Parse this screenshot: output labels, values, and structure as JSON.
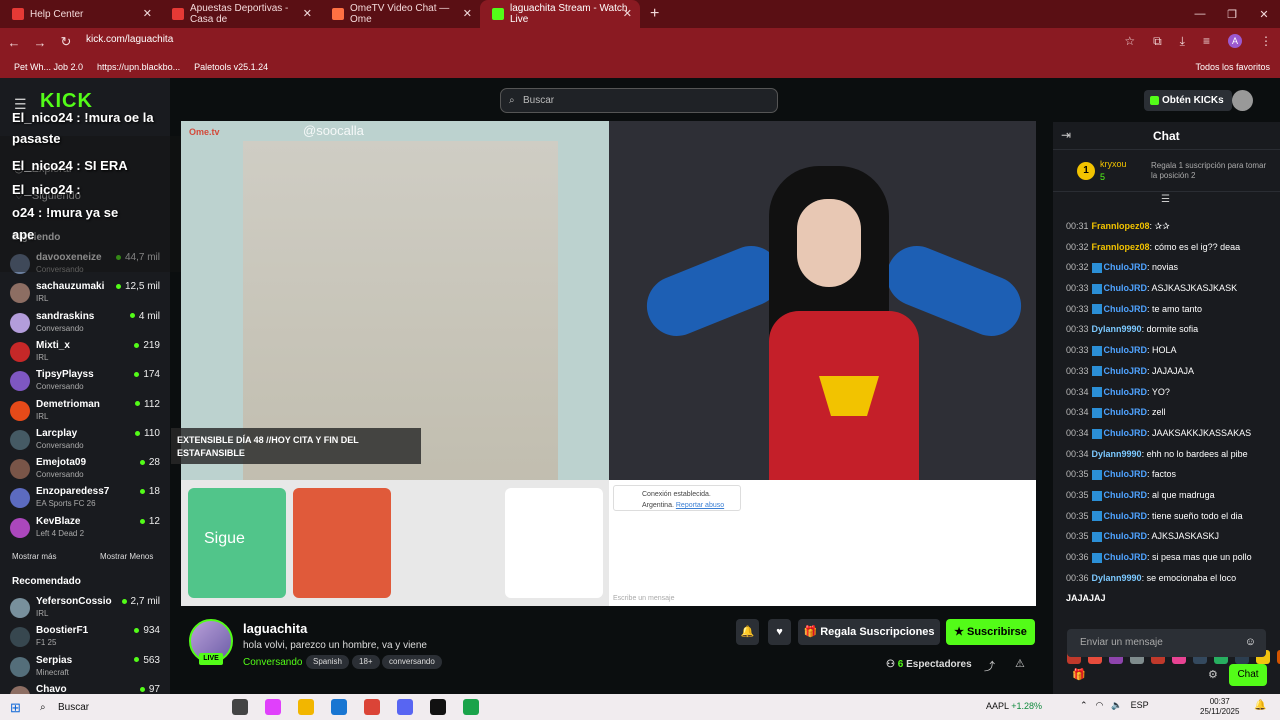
{
  "browser": {
    "tabs": [
      {
        "title": "Help Center",
        "color": "#e53935"
      },
      {
        "title": "Apuestas Deportivas - Casa de",
        "color": "#e53935"
      },
      {
        "title": "OmeTV Video Chat — Ome",
        "color": "#ff7043"
      },
      {
        "title": "laguachita Stream - Watch Live",
        "color": "#53fc18"
      }
    ],
    "url": "kick.com/laguachita",
    "bookmarks": [
      "Pet Wh... Job 2.0",
      "https://upn.blackbo...",
      "Paletools v25.1.24"
    ],
    "bookmarks_right": "Todos los favoritos"
  },
  "overlay_chat": [
    "El_nico24 : !mura oe la",
    "pasaste",
    "El_nico24 : SI ERA",
    "El_nico24 :",
    "o24 : !mura ya se",
    "ape"
  ],
  "sidebar": {
    "logo": "KICK",
    "nav": [
      {
        "label": "Explorar",
        "icon": "compass-icon"
      },
      {
        "label": "Siguiendo",
        "icon": "heart-icon"
      }
    ],
    "following_title": "Siguiendo",
    "following": [
      {
        "name": "davooxeneize",
        "category": "Conversando",
        "viewers": "44,7 mil",
        "color": "#6b7f9e"
      },
      {
        "name": "sachauzumaki",
        "category": "IRL",
        "viewers": "12,5 mil",
        "color": "#8d6e63"
      },
      {
        "name": "sandraskins",
        "category": "Conversando",
        "viewers": "4 mil",
        "color": "#b39ddb"
      },
      {
        "name": "Mixti_x",
        "category": "IRL",
        "viewers": "219",
        "color": "#c62828"
      },
      {
        "name": "TipsyPlayss",
        "category": "Conversando",
        "viewers": "174",
        "color": "#7e57c2"
      },
      {
        "name": "Demetrioman",
        "category": "IRL",
        "viewers": "112",
        "color": "#e64a19"
      },
      {
        "name": "Larcplay",
        "category": "Conversando",
        "viewers": "110",
        "color": "#455a64"
      },
      {
        "name": "Emejota09",
        "category": "Conversando",
        "viewers": "28",
        "color": "#795548"
      },
      {
        "name": "Enzoparedess7",
        "category": "EA Sports FC 26",
        "viewers": "18",
        "color": "#5c6bc0"
      },
      {
        "name": "KevBlaze",
        "category": "Left 4 Dead 2",
        "viewers": "12",
        "color": "#ab47bc"
      }
    ],
    "show_more": "Mostrar más",
    "show_less": "Mostrar Menos",
    "recommended_title": "Recomendado",
    "recommended": [
      {
        "name": "YefersonCossio",
        "category": "IRL",
        "viewers": "2,7 mil",
        "color": "#78909c"
      },
      {
        "name": "BoostierF1",
        "category": "F1 25",
        "viewers": "934",
        "color": "#37474f"
      },
      {
        "name": "Serpias",
        "category": "Minecraft",
        "viewers": "563",
        "color": "#546e7a"
      },
      {
        "name": "Chavo",
        "category": "",
        "viewers": "97",
        "color": "#8d6e63"
      }
    ]
  },
  "header": {
    "search_placeholder": "Buscar",
    "kicks_label": "Obtén KICKs"
  },
  "video": {
    "ome_logo": "Ome.tv",
    "handle": "@soocalla",
    "title_overlay_1": "EXTENSIBLE DÍA 48 //HOY CITA Y FIN DEL",
    "title_overlay_2": "ESTAFANSIBLE",
    "follow_btn": "Sigue",
    "conn_text": "Conexión establecida.",
    "country": "Argentina.",
    "report": "Reportar abuso",
    "msg_placeholder": "Escribe un mensaje"
  },
  "stream": {
    "username": "laguachita",
    "live": "LIVE",
    "title": "hola volvi, parezco un hombre, va y viene",
    "category": "Conversando",
    "tags": [
      "Spanish",
      "18+",
      "conversando"
    ],
    "gift_label": "Regala Suscripciones",
    "subscribe_label": "Suscribirse",
    "viewers": "6",
    "viewers_label": "Espectadores"
  },
  "chat": {
    "title": "Chat",
    "gifter": {
      "rank": "1",
      "name": "kryxou",
      "count": "5",
      "desc": "Regala 1 suscripción para tomar la posición 2"
    },
    "messages": [
      {
        "time": "00:31",
        "user": "Frannlopez08",
        "color": "#f2c300",
        "badge": false,
        "text": ": ✰✰"
      },
      {
        "time": "00:32",
        "user": "Frannlopez08",
        "color": "#f2c300",
        "badge": false,
        "text": ": cómo es el ig?? deaa"
      },
      {
        "time": "00:32",
        "user": "ChuloJRD",
        "color": "#4fa3ff",
        "badge": true,
        "text": ": novias"
      },
      {
        "time": "00:33",
        "user": "ChuloJRD",
        "color": "#4fa3ff",
        "badge": true,
        "text": ": ASJKASJKASJKASK"
      },
      {
        "time": "00:33",
        "user": "ChuloJRD",
        "color": "#4fa3ff",
        "badge": true,
        "text": ": te amo tanto"
      },
      {
        "time": "00:33",
        "user": "Dylann9990",
        "color": "#7cc9ff",
        "badge": false,
        "text": ": dormite sofia"
      },
      {
        "time": "00:33",
        "user": "ChuloJRD",
        "color": "#4fa3ff",
        "badge": true,
        "text": ": HOLA"
      },
      {
        "time": "00:33",
        "user": "ChuloJRD",
        "color": "#4fa3ff",
        "badge": true,
        "text": ": JAJAJAJA"
      },
      {
        "time": "00:34",
        "user": "ChuloJRD",
        "color": "#4fa3ff",
        "badge": true,
        "text": ": YO?"
      },
      {
        "time": "00:34",
        "user": "ChuloJRD",
        "color": "#4fa3ff",
        "badge": true,
        "text": ": zell"
      },
      {
        "time": "00:34",
        "user": "ChuloJRD",
        "color": "#4fa3ff",
        "badge": true,
        "text": ": JAAKSAKKJKASSAKAS"
      },
      {
        "time": "00:34",
        "user": "Dylann9990",
        "color": "#7cc9ff",
        "badge": false,
        "text": ": ehh no lo bardees al pibe"
      },
      {
        "time": "00:35",
        "user": "ChuloJRD",
        "color": "#4fa3ff",
        "badge": true,
        "text": ": factos"
      },
      {
        "time": "00:35",
        "user": "ChuloJRD",
        "color": "#4fa3ff",
        "badge": true,
        "text": ": al que madruga"
      },
      {
        "time": "00:35",
        "user": "ChuloJRD",
        "color": "#4fa3ff",
        "badge": true,
        "text": ": tiene sueño todo el dia"
      },
      {
        "time": "00:35",
        "user": "ChuloJRD",
        "color": "#4fa3ff",
        "badge": true,
        "text": ": AJKSJASKASKJ"
      },
      {
        "time": "00:36",
        "user": "ChuloJRD",
        "color": "#4fa3ff",
        "badge": true,
        "text": ": si pesa mas que un pollo"
      },
      {
        "time": "00:36",
        "user": "Dylann9990",
        "color": "#7cc9ff",
        "badge": false,
        "text": ": se emocionaba el loco"
      }
    ],
    "last_line": "JAJAJAJ",
    "emote_colors": [
      "#c0392b",
      "#e74c3c",
      "#8e44ad",
      "#7f8c8d",
      "#c0392b",
      "#e84393",
      "#34495e",
      "#27ae60",
      "#2c3e50",
      "#f1c40f",
      "#d35400"
    ],
    "input_placeholder": "Enviar un mensaje",
    "send_label": "Chat"
  },
  "taskbar": {
    "search": "Buscar",
    "stock_name": "AAPL",
    "stock_change": "+1.28%",
    "lang": "ESP",
    "time": "00:37",
    "date": "25/11/2025",
    "app_colors": [
      "#444",
      "#e040fb",
      "#f2b600",
      "#1976d2",
      "#db4437",
      "#5865f2",
      "#111",
      "#1aa34a"
    ]
  }
}
